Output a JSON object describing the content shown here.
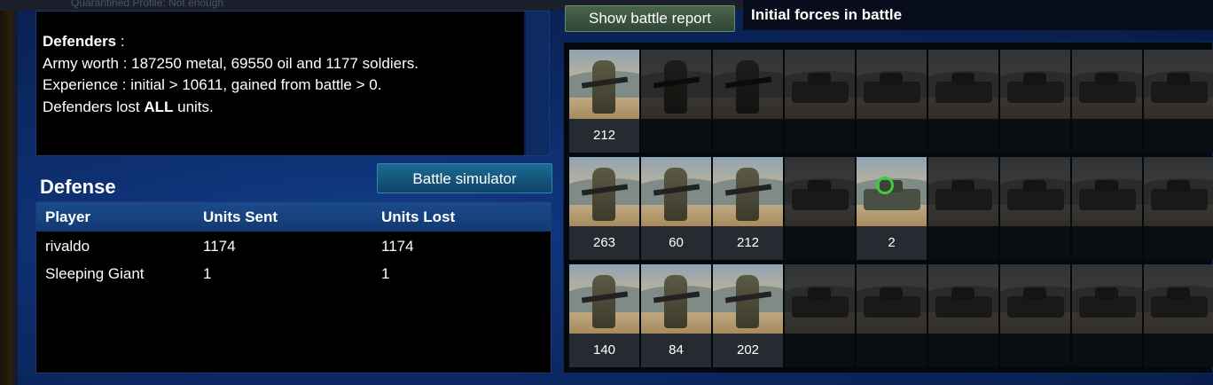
{
  "top_strip": {
    "faded_text": "Quarantined Profile: Not enough"
  },
  "defenders_box": {
    "heading": "Defenders",
    "heading_suffix": " :",
    "army_worth": "Army worth : 187250 metal, 69550 oil and 1177 soldiers.",
    "experience": "Experience : initial > 10611, gained from battle > 0.",
    "lost_prefix": "Defenders lost ",
    "lost_bold": "ALL",
    "lost_suffix": " units."
  },
  "defense": {
    "title": "Defense",
    "simulator_button": "Battle simulator",
    "columns": [
      "Player",
      "Units Sent",
      "Units Lost"
    ],
    "rows": [
      {
        "player": "rivaldo",
        "sent": "1174",
        "lost": "1174"
      },
      {
        "player": "Sleeping Giant",
        "sent": "1",
        "lost": "1"
      }
    ]
  },
  "right_panel": {
    "report_button": "Show battle report",
    "title": "Initial forces in battle",
    "rows": [
      {
        "units": [
          {
            "kind": "soldier",
            "count": "212",
            "active": true
          },
          {
            "kind": "soldier",
            "count": "",
            "active": false
          },
          {
            "kind": "soldier",
            "count": "",
            "active": false
          },
          {
            "kind": "vehicle",
            "count": "",
            "active": false
          },
          {
            "kind": "vehicle",
            "count": "",
            "active": false
          },
          {
            "kind": "vehicle",
            "count": "",
            "active": false
          },
          {
            "kind": "vehicle",
            "count": "",
            "active": false
          },
          {
            "kind": "vehicle",
            "count": "",
            "active": false
          },
          {
            "kind": "vehicle",
            "count": "",
            "active": false
          }
        ]
      },
      {
        "units": [
          {
            "kind": "soldier",
            "count": "263",
            "active": true
          },
          {
            "kind": "soldier",
            "count": "60",
            "active": true
          },
          {
            "kind": "soldier",
            "count": "212",
            "active": true
          },
          {
            "kind": "vehicle",
            "count": "",
            "active": false
          },
          {
            "kind": "radar",
            "count": "2",
            "active": true
          },
          {
            "kind": "vehicle",
            "count": "",
            "active": false
          },
          {
            "kind": "vehicle",
            "count": "",
            "active": false
          },
          {
            "kind": "vehicle",
            "count": "",
            "active": false
          },
          {
            "kind": "vehicle",
            "count": "",
            "active": false
          }
        ]
      },
      {
        "units": [
          {
            "kind": "soldier",
            "count": "140",
            "active": true
          },
          {
            "kind": "soldier",
            "count": "84",
            "active": true
          },
          {
            "kind": "soldier",
            "count": "202",
            "active": true
          },
          {
            "kind": "vehicle",
            "count": "",
            "active": false
          },
          {
            "kind": "vehicle",
            "count": "",
            "active": false
          },
          {
            "kind": "vehicle",
            "count": "",
            "active": false
          },
          {
            "kind": "vehicle",
            "count": "",
            "active": false
          },
          {
            "kind": "vehicle",
            "count": "",
            "active": false
          },
          {
            "kind": "vehicle",
            "count": "",
            "active": false
          }
        ]
      }
    ]
  }
}
